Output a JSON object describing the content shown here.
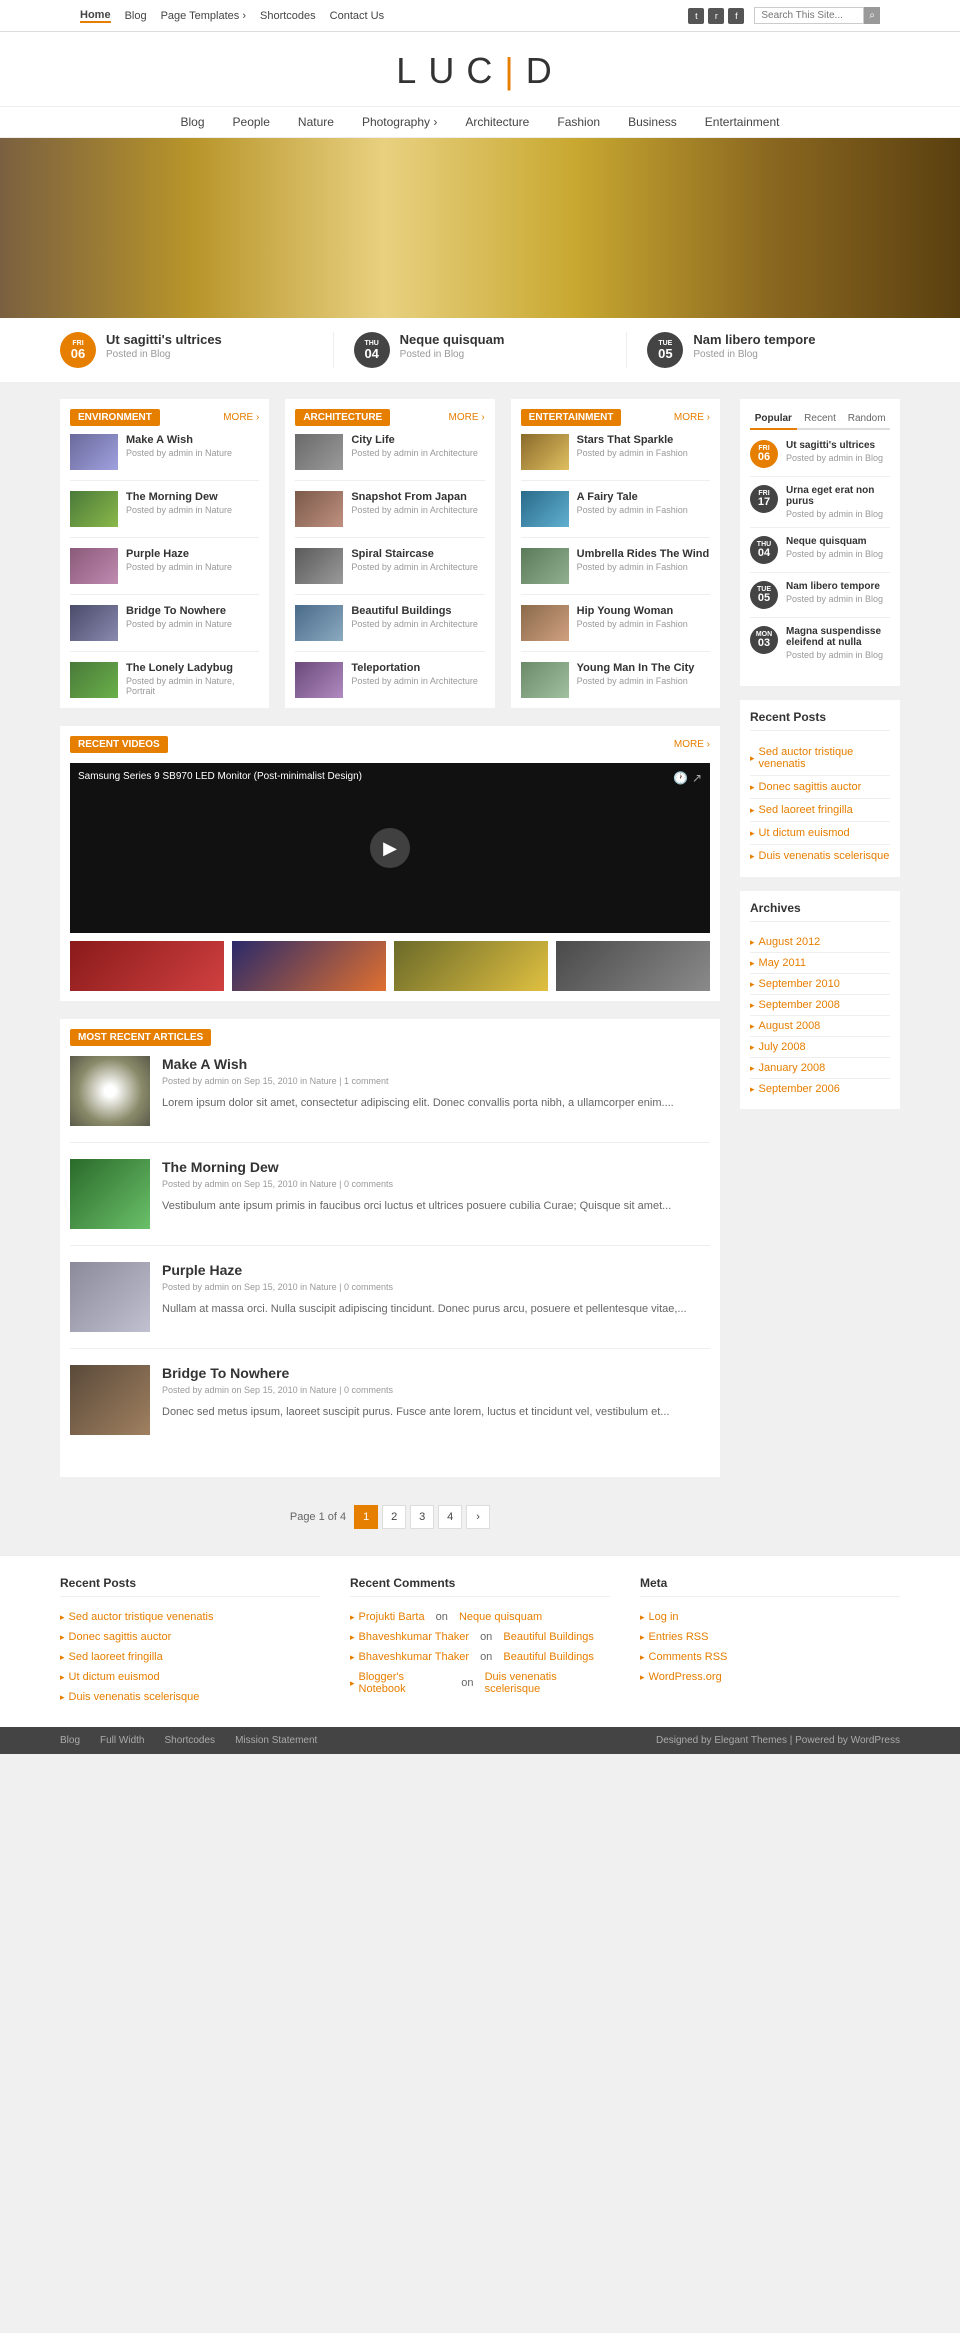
{
  "topnav": {
    "links": [
      {
        "label": "Home",
        "active": true
      },
      {
        "label": "Blog",
        "active": false
      },
      {
        "label": "Page Templates",
        "active": false,
        "has_sub": true
      },
      {
        "label": "Shortcodes",
        "active": false
      },
      {
        "label": "Contact Us",
        "active": false
      }
    ],
    "search_placeholder": "Search This Site..."
  },
  "logo": {
    "text_before": "LUC",
    "bar": "|",
    "text_after": "D"
  },
  "catnav": {
    "links": [
      {
        "label": "Blog"
      },
      {
        "label": "People"
      },
      {
        "label": "Nature"
      },
      {
        "label": "Photography",
        "has_sub": true
      },
      {
        "label": "Architecture"
      },
      {
        "label": "Fashion"
      },
      {
        "label": "Business"
      },
      {
        "label": "Entertainment"
      }
    ]
  },
  "featured_posts": [
    {
      "day": "06",
      "month": "FRI",
      "badge_type": "orange",
      "title": "Ut sagitti's ultrices",
      "cat": "Posted in Blog"
    },
    {
      "day": "04",
      "month": "THU",
      "badge_type": "dark",
      "title": "Neque quisquam",
      "cat": "Posted in Blog"
    },
    {
      "day": "05",
      "month": "TUE",
      "badge_type": "dark",
      "title": "Nam libero tempore",
      "cat": "Posted in Blog"
    }
  ],
  "environment_section": {
    "tag": "ENVIRONMENT",
    "more": "MORE ›",
    "posts": [
      {
        "title": "Make A Wish",
        "meta": "Posted by admin in Nature",
        "thumb": "wish"
      },
      {
        "title": "The Morning Dew",
        "meta": "Posted by admin in Nature",
        "thumb": "green"
      },
      {
        "title": "Purple Haze",
        "meta": "Posted by admin in Nature",
        "thumb": "purple"
      },
      {
        "title": "Bridge To Nowhere",
        "meta": "Posted by admin in Nature",
        "thumb": "bridge"
      },
      {
        "title": "The Lonely Ladybug",
        "meta": "Posted by admin in Nature, Portrait",
        "thumb": "ladybug"
      }
    ]
  },
  "architecture_section": {
    "tag": "ARCHITECTURE",
    "more": "MORE ›",
    "posts": [
      {
        "title": "City Life",
        "meta": "Posted by admin in Architecture",
        "thumb": "city"
      },
      {
        "title": "Snapshot From Japan",
        "meta": "Posted by admin in Architecture",
        "thumb": "japan"
      },
      {
        "title": "Spiral Staircase",
        "meta": "Posted by admin in Architecture",
        "thumb": "spiral"
      },
      {
        "title": "Beautiful Buildings",
        "meta": "Posted by admin in Architecture",
        "thumb": "buildings"
      },
      {
        "title": "Teleportation",
        "meta": "Posted by admin in Architecture",
        "thumb": "teleport"
      }
    ]
  },
  "entertainment_section": {
    "tag": "ENTERTAINMENT",
    "more": "MORE ›",
    "posts": [
      {
        "title": "Stars That Sparkle",
        "meta": "Posted by admin in Fashion",
        "thumb": "stars"
      },
      {
        "title": "A Fairy Tale",
        "meta": "Posted by admin in Fashion",
        "thumb": "fairy"
      },
      {
        "title": "Umbrella Rides The Wind",
        "meta": "Posted by admin in Fashion",
        "thumb": "umbrella"
      },
      {
        "title": "Hip Young Woman",
        "meta": "Posted by admin in Fashion",
        "thumb": "hipwoman"
      },
      {
        "title": "Young Man In The City",
        "meta": "Posted by admin in Fashion",
        "thumb": "youngman"
      }
    ]
  },
  "recent_videos": {
    "tag": "RECENT VIDEOS",
    "more": "MORE ›",
    "video_title": "Samsung Series 9 SB970 LED Monitor (Post-minimalist Design)"
  },
  "most_recent": {
    "tag": "MOST RECENT ARTICLES",
    "articles": [
      {
        "title": "Make A Wish",
        "meta": "Posted by admin on Sep 15, 2010 in Nature | 1 comment",
        "excerpt": "Lorem ipsum dolor sit amet, consectetur adipiscing elit. Donec convallis porta nibh, a ullamcorper enim....",
        "thumb": "wish-art"
      },
      {
        "title": "The Morning Dew",
        "meta": "Posted by admin on Sep 15, 2010 in Nature | 0 comments",
        "excerpt": "Vestibulum ante ipsum primis in faucibus orci luctus et ultrices posuere cubilia Curae; Quisque sit amet...",
        "thumb": "dew-art"
      },
      {
        "title": "Purple Haze",
        "meta": "Posted by admin on Sep 15, 2010 in Nature | 0 comments",
        "excerpt": "Nullam at massa orci. Nulla suscipit adipiscing tincidunt. Donec purus arcu, posuere et pellentesque vitae,...",
        "thumb": "purple-art"
      },
      {
        "title": "Bridge To Nowhere",
        "meta": "Posted by admin on Sep 15, 2010 in Nature | 0 comments",
        "excerpt": "Donec sed metus ipsum, laoreet suscipit purus. Fusce ante lorem, luctus et tincidunt vel, vestibulum et...",
        "thumb": "bridge-art"
      }
    ]
  },
  "pagination": {
    "label": "Page 1 of 4",
    "pages": [
      "1",
      "2",
      "3",
      "4"
    ],
    "next": "›"
  },
  "sidebar": {
    "tabs": [
      "Popular",
      "Recent",
      "Random"
    ],
    "active_tab": "Popular",
    "popular_posts": [
      {
        "num": "06",
        "month": "FRI",
        "badge": "orange",
        "title": "Ut sagitti's ultrices",
        "meta": "Posted by admin in Blog"
      },
      {
        "num": "17",
        "month": "FRI",
        "badge": "dark",
        "title": "Urna eget erat non purus",
        "meta": "Posted by admin in Blog"
      },
      {
        "num": "04",
        "month": "THU",
        "badge": "dark",
        "title": "Neque quisquam",
        "meta": "Posted by admin in Blog"
      },
      {
        "num": "05",
        "month": "TUE",
        "badge": "dark",
        "title": "Nam libero tempore",
        "meta": "Posted by admin in Blog"
      },
      {
        "num": "03",
        "month": "MON",
        "badge": "dark",
        "title": "Magna suspendisse eleifend at nulla",
        "meta": "Posted by admin in Blog"
      }
    ],
    "recent_posts_title": "Recent Posts",
    "recent_posts": [
      "Sed auctor tristique venenatis",
      "Donec sagittis auctor",
      "Sed laoreet fringilla",
      "Ut dictum euismod",
      "Duis venenatis scelerisque"
    ],
    "archives_title": "Archives",
    "archives": [
      "August 2012",
      "May 2011",
      "September 2010",
      "September 2008",
      "August 2008",
      "July 2008",
      "January 2008",
      "September 2006"
    ]
  },
  "footer": {
    "recent_posts_title": "Recent Posts",
    "recent_posts": [
      "Sed auctor tristique venenatis",
      "Donec sagittis auctor",
      "Sed laoreet fringilla",
      "Ut dictum euismod",
      "Duis venenatis scelerisque"
    ],
    "recent_comments_title": "Recent Comments",
    "recent_comments": [
      {
        "author": "Projukti Barta",
        "on": "on",
        "post": "Neque quisquam"
      },
      {
        "author": "Bhaveshkumar Thaker",
        "on": "on",
        "post": "Beautiful Buildings"
      },
      {
        "author": "Bhaveshkumar Thaker",
        "on": "on",
        "post": "Beautiful Buildings"
      },
      {
        "author": "Blogger's Notebook",
        "on": "on",
        "post": "Duis venenatis scelerisque"
      }
    ],
    "meta_title": "Meta",
    "meta_links": [
      "Log in",
      "Entries RSS",
      "Comments RSS",
      "WordPress.org"
    ],
    "bottom_links": [
      "Blog",
      "Full Width",
      "Shortcodes",
      "Mission Statement"
    ],
    "credit": "Designed by Elegant Themes | Powered by WordPress"
  }
}
